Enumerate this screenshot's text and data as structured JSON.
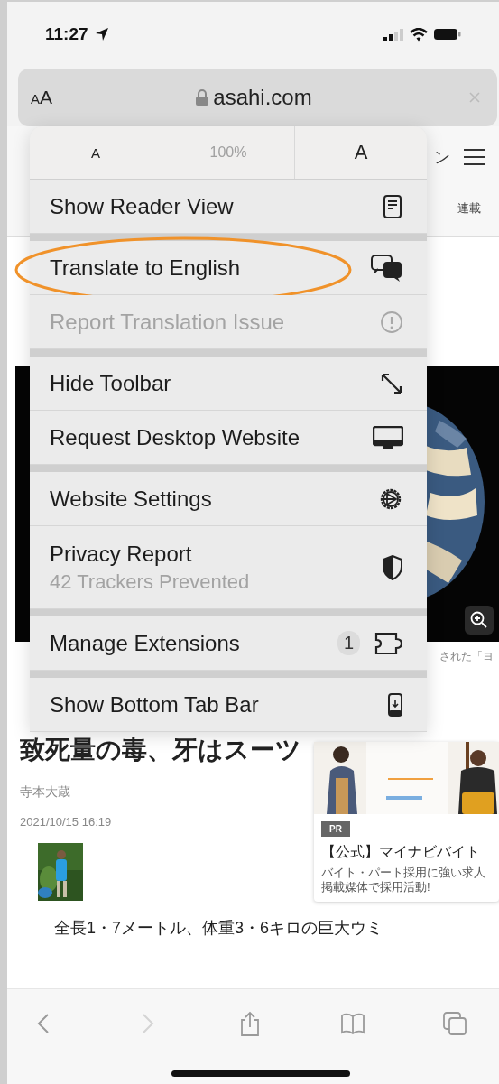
{
  "status_bar": {
    "time": "11:27"
  },
  "address_bar": {
    "text_size": "AA",
    "domain": "asahi.com"
  },
  "page": {
    "nav_fragment": "ン",
    "subnav_label": "連載",
    "caption_fragment": "された「ヨ",
    "headline": "致死量の毒、牙はスーツ",
    "author": "寺本大蔵",
    "date": "2021/10/15 16:19",
    "body": "全長1・7メートル、体重3・6キロの巨大ウミ"
  },
  "ad": {
    "kind": "picture",
    "tag": "PR",
    "title": "【公式】マイナビバイト",
    "description": "バイト・パート採用に強い求人掲載媒体で採用活動!"
  },
  "menu": {
    "zoom": [
      {
        "kind": "decrease",
        "label": "A"
      },
      {
        "kind": "level",
        "label": "100%"
      },
      {
        "kind": "increase",
        "label": "A"
      }
    ],
    "sections": [
      [
        {
          "label": "Show Reader View",
          "disabled": false,
          "circled": false
        }
      ],
      [
        {
          "label": "Translate to English",
          "disabled": false,
          "circled": true
        },
        {
          "label": "Report Translation Issue",
          "disabled": true,
          "circled": false
        }
      ],
      [
        {
          "label": "Hide Toolbar",
          "disabled": false,
          "circled": false
        },
        {
          "label": "Request Desktop Website",
          "disabled": false,
          "circled": false
        }
      ],
      [
        {
          "label": "Website Settings",
          "disabled": false,
          "circled": false
        },
        {
          "label": "Privacy Report",
          "subtitle": "42 Trackers Prevented",
          "disabled": false,
          "circled": false
        }
      ],
      [
        {
          "label": "Manage Extensions",
          "badge": "1",
          "disabled": false,
          "circled": false
        }
      ],
      [
        {
          "label": "Show Bottom Tab Bar",
          "disabled": false,
          "circled": false
        }
      ]
    ]
  },
  "toolbar": {
    "buttons": [
      {
        "disabled": false
      },
      {
        "disabled": true
      },
      {
        "disabled": false
      },
      {
        "disabled": false
      },
      {
        "disabled": false
      }
    ]
  }
}
